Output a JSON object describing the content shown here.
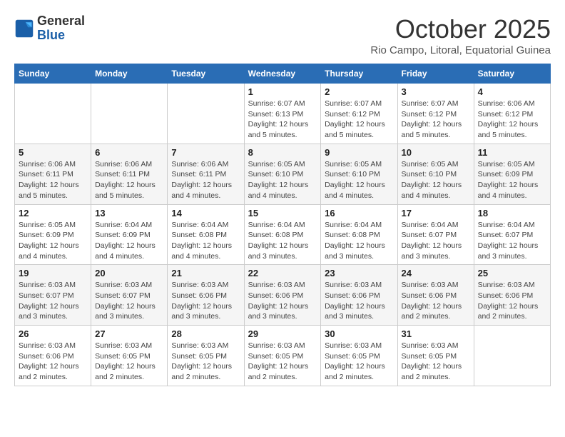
{
  "header": {
    "logo_general": "General",
    "logo_blue": "Blue",
    "month": "October 2025",
    "location": "Rio Campo, Litoral, Equatorial Guinea"
  },
  "weekdays": [
    "Sunday",
    "Monday",
    "Tuesday",
    "Wednesday",
    "Thursday",
    "Friday",
    "Saturday"
  ],
  "weeks": [
    [
      {
        "day": "",
        "info": ""
      },
      {
        "day": "",
        "info": ""
      },
      {
        "day": "",
        "info": ""
      },
      {
        "day": "1",
        "info": "Sunrise: 6:07 AM\nSunset: 6:13 PM\nDaylight: 12 hours\nand 5 minutes."
      },
      {
        "day": "2",
        "info": "Sunrise: 6:07 AM\nSunset: 6:12 PM\nDaylight: 12 hours\nand 5 minutes."
      },
      {
        "day": "3",
        "info": "Sunrise: 6:07 AM\nSunset: 6:12 PM\nDaylight: 12 hours\nand 5 minutes."
      },
      {
        "day": "4",
        "info": "Sunrise: 6:06 AM\nSunset: 6:12 PM\nDaylight: 12 hours\nand 5 minutes."
      }
    ],
    [
      {
        "day": "5",
        "info": "Sunrise: 6:06 AM\nSunset: 6:11 PM\nDaylight: 12 hours\nand 5 minutes."
      },
      {
        "day": "6",
        "info": "Sunrise: 6:06 AM\nSunset: 6:11 PM\nDaylight: 12 hours\nand 5 minutes."
      },
      {
        "day": "7",
        "info": "Sunrise: 6:06 AM\nSunset: 6:11 PM\nDaylight: 12 hours\nand 4 minutes."
      },
      {
        "day": "8",
        "info": "Sunrise: 6:05 AM\nSunset: 6:10 PM\nDaylight: 12 hours\nand 4 minutes."
      },
      {
        "day": "9",
        "info": "Sunrise: 6:05 AM\nSunset: 6:10 PM\nDaylight: 12 hours\nand 4 minutes."
      },
      {
        "day": "10",
        "info": "Sunrise: 6:05 AM\nSunset: 6:10 PM\nDaylight: 12 hours\nand 4 minutes."
      },
      {
        "day": "11",
        "info": "Sunrise: 6:05 AM\nSunset: 6:09 PM\nDaylight: 12 hours\nand 4 minutes."
      }
    ],
    [
      {
        "day": "12",
        "info": "Sunrise: 6:05 AM\nSunset: 6:09 PM\nDaylight: 12 hours\nand 4 minutes."
      },
      {
        "day": "13",
        "info": "Sunrise: 6:04 AM\nSunset: 6:09 PM\nDaylight: 12 hours\nand 4 minutes."
      },
      {
        "day": "14",
        "info": "Sunrise: 6:04 AM\nSunset: 6:08 PM\nDaylight: 12 hours\nand 4 minutes."
      },
      {
        "day": "15",
        "info": "Sunrise: 6:04 AM\nSunset: 6:08 PM\nDaylight: 12 hours\nand 3 minutes."
      },
      {
        "day": "16",
        "info": "Sunrise: 6:04 AM\nSunset: 6:08 PM\nDaylight: 12 hours\nand 3 minutes."
      },
      {
        "day": "17",
        "info": "Sunrise: 6:04 AM\nSunset: 6:07 PM\nDaylight: 12 hours\nand 3 minutes."
      },
      {
        "day": "18",
        "info": "Sunrise: 6:04 AM\nSunset: 6:07 PM\nDaylight: 12 hours\nand 3 minutes."
      }
    ],
    [
      {
        "day": "19",
        "info": "Sunrise: 6:03 AM\nSunset: 6:07 PM\nDaylight: 12 hours\nand 3 minutes."
      },
      {
        "day": "20",
        "info": "Sunrise: 6:03 AM\nSunset: 6:07 PM\nDaylight: 12 hours\nand 3 minutes."
      },
      {
        "day": "21",
        "info": "Sunrise: 6:03 AM\nSunset: 6:06 PM\nDaylight: 12 hours\nand 3 minutes."
      },
      {
        "day": "22",
        "info": "Sunrise: 6:03 AM\nSunset: 6:06 PM\nDaylight: 12 hours\nand 3 minutes."
      },
      {
        "day": "23",
        "info": "Sunrise: 6:03 AM\nSunset: 6:06 PM\nDaylight: 12 hours\nand 3 minutes."
      },
      {
        "day": "24",
        "info": "Sunrise: 6:03 AM\nSunset: 6:06 PM\nDaylight: 12 hours\nand 2 minutes."
      },
      {
        "day": "25",
        "info": "Sunrise: 6:03 AM\nSunset: 6:06 PM\nDaylight: 12 hours\nand 2 minutes."
      }
    ],
    [
      {
        "day": "26",
        "info": "Sunrise: 6:03 AM\nSunset: 6:06 PM\nDaylight: 12 hours\nand 2 minutes."
      },
      {
        "day": "27",
        "info": "Sunrise: 6:03 AM\nSunset: 6:05 PM\nDaylight: 12 hours\nand 2 minutes."
      },
      {
        "day": "28",
        "info": "Sunrise: 6:03 AM\nSunset: 6:05 PM\nDaylight: 12 hours\nand 2 minutes."
      },
      {
        "day": "29",
        "info": "Sunrise: 6:03 AM\nSunset: 6:05 PM\nDaylight: 12 hours\nand 2 minutes."
      },
      {
        "day": "30",
        "info": "Sunrise: 6:03 AM\nSunset: 6:05 PM\nDaylight: 12 hours\nand 2 minutes."
      },
      {
        "day": "31",
        "info": "Sunrise: 6:03 AM\nSunset: 6:05 PM\nDaylight: 12 hours\nand 2 minutes."
      },
      {
        "day": "",
        "info": ""
      }
    ]
  ]
}
